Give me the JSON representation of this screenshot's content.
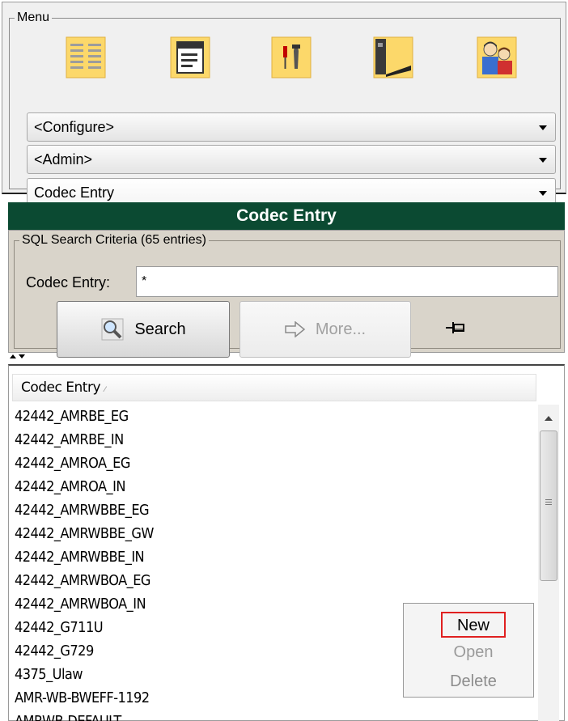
{
  "menu": {
    "legend": "Menu",
    "icons": [
      {
        "name": "list-view-icon"
      },
      {
        "name": "form-view-icon"
      },
      {
        "name": "tools-icon"
      },
      {
        "name": "server-icon"
      },
      {
        "name": "users-icon"
      }
    ],
    "combos": {
      "configure": "<Configure>",
      "admin": "<Admin>",
      "current": "Codec Entry"
    }
  },
  "header": {
    "title": "Codec Entry"
  },
  "search": {
    "legend": "SQL Search Criteria (65 entries)",
    "field_label": "Codec Entry:",
    "field_value": "*",
    "search_button": "Search",
    "more_button": "More..."
  },
  "list": {
    "column_header": "Codec Entry",
    "rows": [
      "42442_AMRBE_EG",
      "42442_AMRBE_IN",
      "42442_AMROA_EG",
      "42442_AMROA_IN",
      "42442_AMRWBBE_EG",
      "42442_AMRWBBE_GW",
      "42442_AMRWBBE_IN",
      "42442_AMRWBOA_EG",
      "42442_AMRWBOA_IN",
      "42442_G711U",
      "42442_G729",
      "4375_Ulaw",
      "AMR-WB-BWEFF-1192",
      "AMRWB-DEFAULT"
    ]
  },
  "popup": {
    "new": "New",
    "open": "Open",
    "delete": "Delete"
  },
  "colors": {
    "header_bg": "#0b4a32",
    "search_panel_bg": "#d9d4ca",
    "highlight_border": "#e02020"
  }
}
